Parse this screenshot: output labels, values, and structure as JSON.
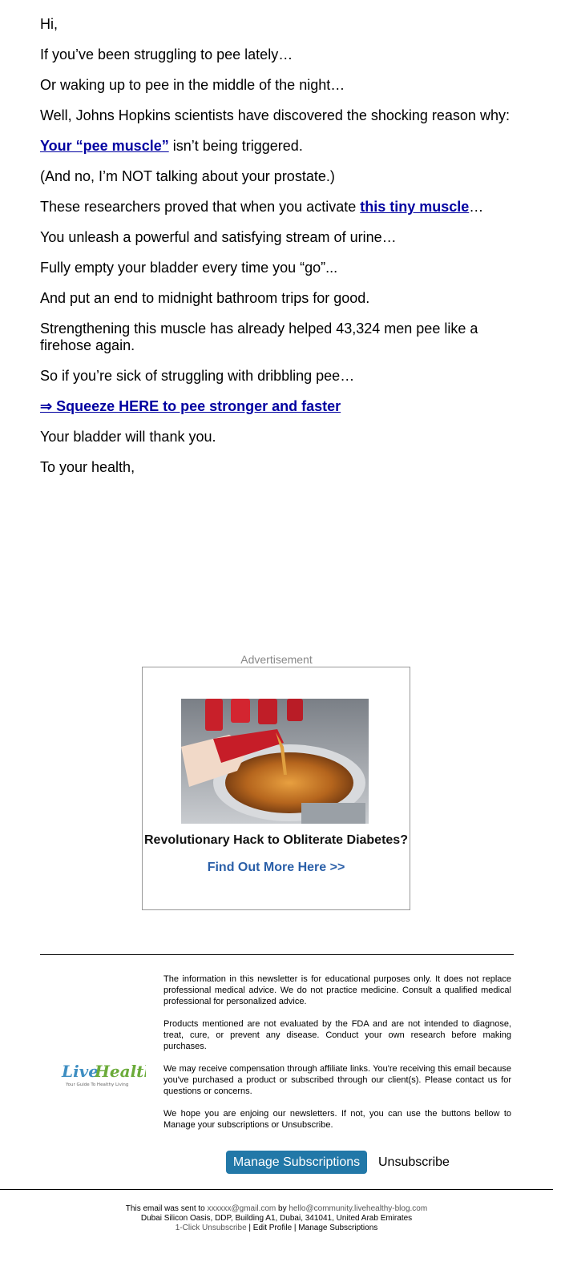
{
  "body": {
    "greeting": "Hi,",
    "p1": "If you’ve been struggling to pee lately…",
    "p2": "Or waking up to pee in the middle of the night…",
    "p3": "Well, Johns Hopkins scientists have discovered the shocking reason why:",
    "p4_link": "Your “pee muscle”",
    "p4_rest": " isn’t being triggered.",
    "p5": "(And no, I’m NOT talking about your prostate.)",
    "p6_start": "These researchers proved that when you activate ",
    "p6_link": "this tiny muscle",
    "p6_end": "…",
    "p7": "You unleash a powerful and satisfying stream of urine…",
    "p8": "Fully empty your bladder every time you “go”...",
    "p9": "And put an end to midnight bathroom trips for good.",
    "p10": "Strengthening this muscle has already helped 43,324 men pee like a firehose again.",
    "p11": "So if you’re sick of struggling with dribbling pee…",
    "cta_link": "⇒ Squeeze HERE to pee stronger and faster",
    "p12": "Your bladder will thank you.",
    "signoff": "To your health,"
  },
  "ad": {
    "label": "Advertisement",
    "headline": "Revolutionary Hack to Obliterate Diabetes?",
    "cta": "Find Out More Here >>"
  },
  "logo": {
    "brand": "LiveHealthy",
    "tagline": "Your Guide To Healthy Living"
  },
  "disclaimers": [
    "The information in this newsletter is for educational purposes only. It does not replace professional medical advice. We do not practice medicine. Consult a qualified medical professional for personalized advice.",
    "Products mentioned are not evaluated by the FDA and are not intended to diagnose, treat, cure, or prevent any disease. Conduct your own research before making purchases.",
    "We may receive compensation through affiliate links. You're receiving this email because you've purchased a product or subscribed through our client(s). Please contact us for questions or concerns.",
    "We hope you are enjoing our newsletters. If not, you can use the buttons bellow to Manage your subscriptions or Unsubscribe."
  ],
  "buttons": {
    "manage": "Manage Subscriptions",
    "unsubscribe": "Unsubscribe"
  },
  "footer": {
    "sent_prefix": "This email was sent to ",
    "email": "xxxxxx@gmail.com",
    "by": " by ",
    "sender": "hello@community.livehealthy-blog.com",
    "address": "Dubai Silicon Oasis, DDP, Building A1, Dubai, 341041, United Arab Emirates",
    "one_click": "1-Click Unsubscribe",
    "sep": " | ",
    "edit_profile": "Edit Profile",
    "manage": "Manage Subscriptions"
  },
  "colors": {
    "link": "#0000a0",
    "button": "#2278a8",
    "ad_cta": "#2a5fa8"
  }
}
